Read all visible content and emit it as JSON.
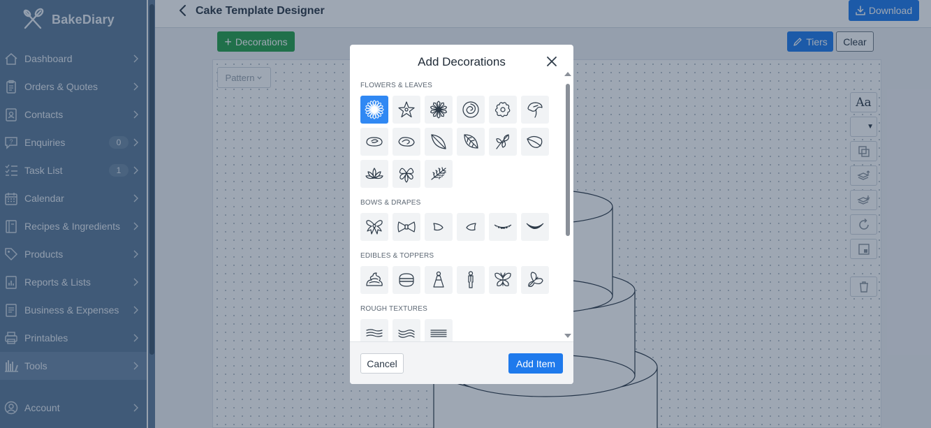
{
  "app": {
    "brand": "BakeDiary"
  },
  "sidebar": {
    "items": [
      {
        "label": "Dashboard",
        "icon": "home-icon"
      },
      {
        "label": "Orders & Quotes",
        "icon": "clipboard-icon"
      },
      {
        "label": "Contacts",
        "icon": "contact-card-icon"
      },
      {
        "label": "Enquiries",
        "icon": "question-chat-icon",
        "badge": "0"
      },
      {
        "label": "Task List",
        "icon": "checklist-icon",
        "badge": "1"
      },
      {
        "label": "Calendar",
        "icon": "calendar-icon"
      },
      {
        "label": "Recipes & Ingredients",
        "icon": "recipe-book-icon"
      },
      {
        "label": "Products",
        "icon": "tag-icon"
      },
      {
        "label": "Reports & Lists",
        "icon": "report-icon"
      },
      {
        "label": "Business & Expenses",
        "icon": "ledger-icon"
      },
      {
        "label": "Printables",
        "icon": "printer-icon"
      },
      {
        "label": "Tools",
        "icon": "tools-icon",
        "active": true
      },
      {
        "label": "Account",
        "icon": "account-icon"
      }
    ]
  },
  "header": {
    "title": "Cake Template Designer",
    "download_label": "Download"
  },
  "toolbar": {
    "decorations_label": "Decorations",
    "tiers_label": "Tiers",
    "clear_label": "Clear",
    "pattern_label": "Pattern"
  },
  "modal": {
    "title": "Add Decorations",
    "sections": [
      {
        "title": "Flowers & Leaves",
        "items": [
          "sunflower-icon",
          "star-flower-icon",
          "daisy-icon",
          "rose-icon",
          "blossom-icon",
          "calla-lily-icon",
          "rose-bud-icon",
          "rose-bud-side-icon",
          "leaf-icon",
          "leaf-veined-icon",
          "leaf-sprig-icon",
          "leaf-round-icon",
          "lotus-icon",
          "pansy-icon",
          "foliage-icon"
        ]
      },
      {
        "title": "Bows & Drapes",
        "items": [
          "bow-icon",
          "bow-tie-icon",
          "drape-left-icon",
          "drape-right-icon",
          "swag-drape-icon",
          "swag-drape-alt-icon"
        ]
      },
      {
        "title": "Edibles & Toppers",
        "items": [
          "cream-swirl-icon",
          "macaron-icon",
          "bride-topper-icon",
          "groom-topper-icon",
          "butterfly-icon",
          "butterfly-side-icon"
        ]
      },
      {
        "title": "Rough Textures",
        "items": [
          "texture-waves-icon",
          "texture-ripple-icon",
          "texture-lines-icon"
        ]
      }
    ],
    "cancel_label": "Cancel",
    "add_label": "Add Item",
    "selected_item": "sunflower-icon"
  },
  "colors": {
    "sidebar": "#5d7a99",
    "primary": "#1f7aec",
    "success": "#27a04a",
    "selected": "#3088f3"
  }
}
